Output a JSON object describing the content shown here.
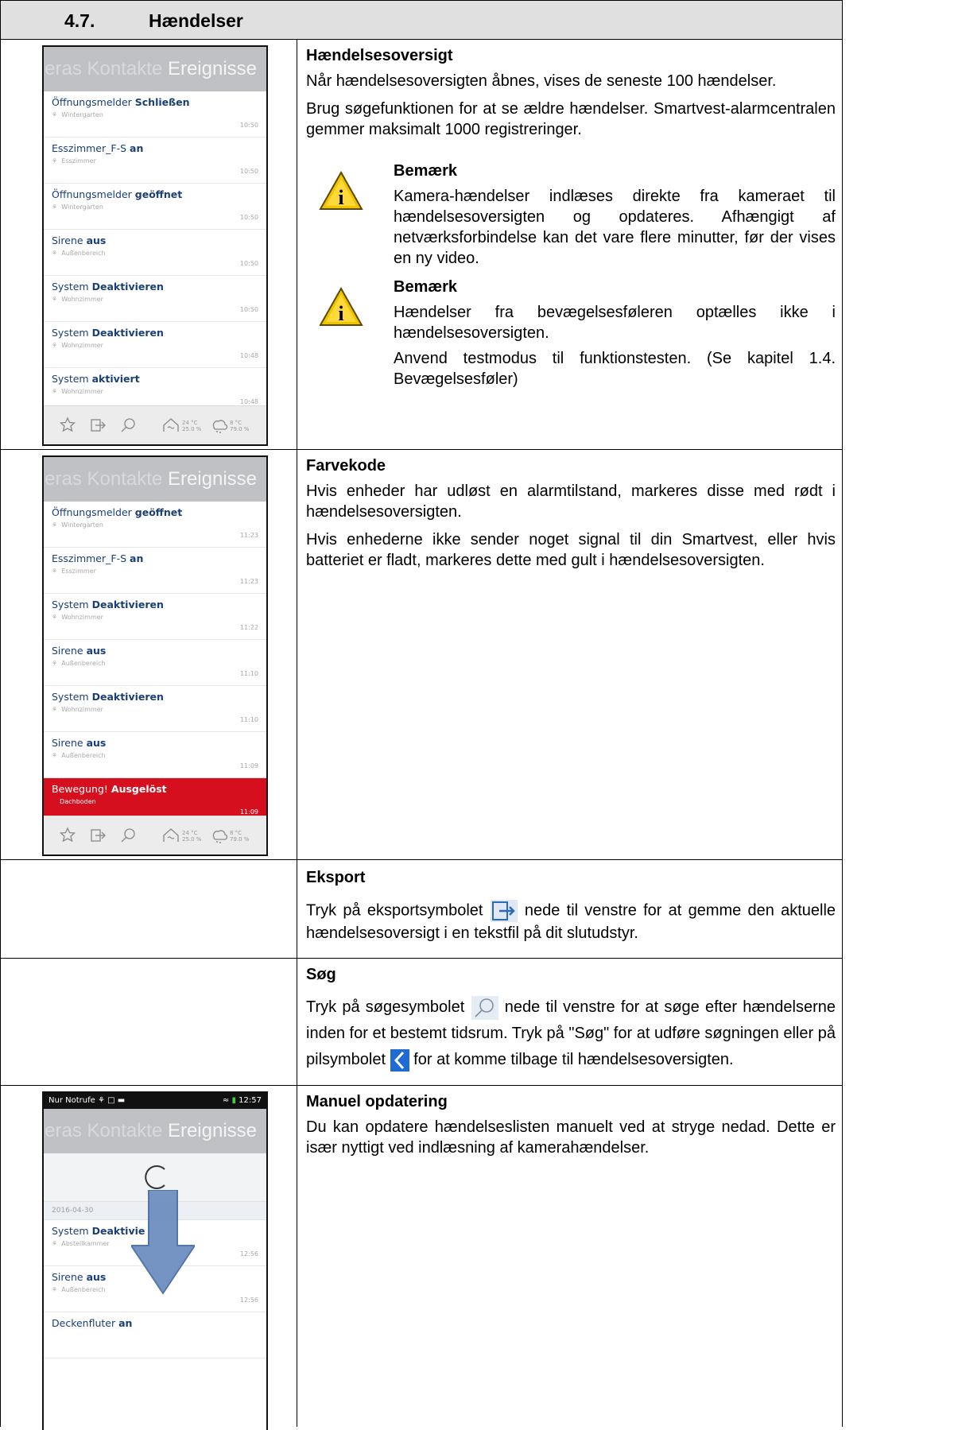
{
  "header": {
    "number": "4.7.",
    "title": "Hændelser"
  },
  "sections": {
    "overview": {
      "heading": "Hændelsesoversigt",
      "p1": "Når hændelsesoversigten åbnes, vises de seneste 100 hændelser.",
      "p2": "Brug søgefunktionen for at se ældre hændelser. Smartvest-alarmcentralen gemmer maksimalt 1000 registreringer.",
      "note1_title": "Bemærk",
      "note1_text": "Kamera-hændelser indlæses direkte fra kameraet til hændelsesoversigten og opdateres. Afhængigt af netværksforbindelse kan det vare flere minutter, før der vises en ny video.",
      "note2_title": "Bemærk",
      "note2_text": "Hændelser fra bevægelsesføleren optælles ikke i hændelsesoversigten.",
      "note2_text2": "Anvend testmodus til funktionstesten. (Se kapitel 1.4. Bevægelsesføler)"
    },
    "color": {
      "heading": "Farvekode",
      "p1": "Hvis enheder har udløst en alarmtilstand, markeres disse med rødt i hændelsesoversigten.",
      "p2": "Hvis enhederne ikke sender noget signal til din Smartvest, eller hvis batteriet er fladt, markeres dette med gult i hændelsesoversigten."
    },
    "export": {
      "heading": "Eksport",
      "before": "Tryk på eksportsymbolet",
      "after": "nede til venstre for at gemme den aktuelle hændelsesoversigt i en tekstfil på dit slutudstyr."
    },
    "search": {
      "heading": "Søg",
      "before": "Tryk på søgesymbolet",
      "middle": "nede til venstre for at søge efter hændelserne inden for et bestemt tidsrum. Tryk på \"Søg\" for at udføre søgningen eller på pilsymbolet",
      "after": "for at komme tilbage til hændelsesoversigten."
    },
    "manual": {
      "heading": "Manuel opdatering",
      "p1": "Du kan opdatere hændelseslisten manuelt ved at stryge nedad. Dette er især nyttigt ved indlæsning af kamerahændelser."
    }
  },
  "phone1": {
    "title_dim": "eras Kontakte",
    "title": "Ereignisse",
    "items": [
      {
        "device": "Öffnungsmelder",
        "state": "Schließen",
        "room": "Wintergarten",
        "time": "10:50"
      },
      {
        "device": "Esszimmer_F-S",
        "state": "an",
        "room": "Esszimmer",
        "time": "10:50"
      },
      {
        "device": "Öffnungsmelder",
        "state": "geöffnet",
        "room": "Wintergarten",
        "time": "10:50"
      },
      {
        "device": "Sirene",
        "state": "aus",
        "room": "Außenbereich",
        "time": "10:50"
      },
      {
        "device": "System",
        "state": "Deaktivieren",
        "room": "Wohnzimmer",
        "time": "10:50"
      },
      {
        "device": "System",
        "state": "Deaktivieren",
        "room": "Wohnzimmer",
        "time": "10:48"
      },
      {
        "device": "System",
        "state": "aktiviert",
        "room": "Wohnzimmer",
        "time": "10:48"
      }
    ],
    "weather_in": "24 °C\n25.0 %",
    "weather_out": "8 °C\n79.0 %"
  },
  "phone2": {
    "title_dim": "eras Kontakte",
    "title": "Ereignisse",
    "items": [
      {
        "device": "Öffnungsmelder",
        "state": "geöffnet",
        "room": "Wintergarten",
        "time": "11:23"
      },
      {
        "device": "Esszimmer_F-S",
        "state": "an",
        "room": "Esszimmer",
        "time": "11:23"
      },
      {
        "device": "System",
        "state": "Deaktivieren",
        "room": "Wohnzimmer",
        "time": "11:22"
      },
      {
        "device": "Sirene",
        "state": "aus",
        "room": "Außenbereich",
        "time": "11:10"
      },
      {
        "device": "System",
        "state": "Deaktivieren",
        "room": "Wohnzimmer",
        "time": "11:10"
      },
      {
        "device": "Sirene",
        "state": "aus",
        "room": "Außenbereich",
        "time": "11:09"
      },
      {
        "device": "Bewegung!",
        "state": "Ausgelöst",
        "room": "Dachboden",
        "time": "11:09",
        "alarm": true
      }
    ],
    "weather_in": "24 °C\n25.0 %",
    "weather_out": "8 °C\n79.0 %"
  },
  "phone3": {
    "status_left": "Nur Notrufe",
    "status_time": "12:57",
    "title_dim": "eras Kontakte",
    "title": "Ereignisse",
    "date": "2016-04-30",
    "items": [
      {
        "device": "System",
        "state": "Deaktivie",
        "room": "Abstellkammer",
        "time": "12:56"
      },
      {
        "device": "Sirene",
        "state": "aus",
        "room": "Außenbereich",
        "time": "12:56"
      },
      {
        "device": "Deckenfluter",
        "state": "an",
        "room": "",
        "time": ""
      }
    ]
  },
  "colors": {
    "alarm_red": "#d60f1e",
    "link_blue": "#1a3f78",
    "header_gray": "#e0e0e0"
  }
}
